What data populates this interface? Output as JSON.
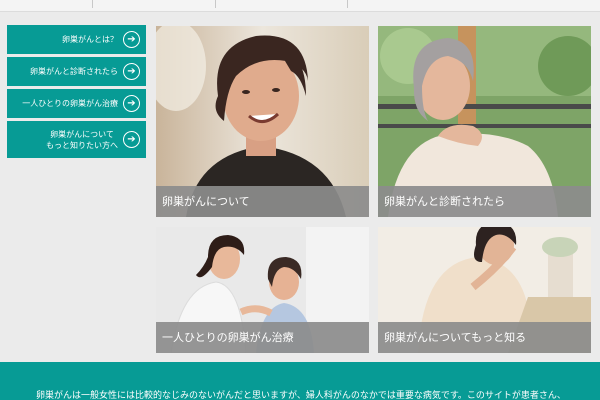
{
  "sidebar": {
    "items": [
      {
        "label": "卵巣がんとは？",
        "icon": "arrow-right-circle-icon"
      },
      {
        "label": "卵巣がんと診断されたら",
        "icon": "arrow-right-circle-icon"
      },
      {
        "label": "一人ひとりの卵巣がん治療",
        "icon": "arrow-right-circle-icon"
      },
      {
        "label": "卵巣がんについて\nもっと知りたい方へ",
        "icon": "arrow-right-circle-icon"
      }
    ]
  },
  "cards": [
    {
      "caption": "卵巣がんについて"
    },
    {
      "caption": "卵巣がんと診断されたら"
    },
    {
      "caption": "一人ひとりの卵巣がん治療"
    },
    {
      "caption": "卵巣がんについてもっと知る"
    }
  ],
  "footer": {
    "text": "卵巣がんは一般女性には比較的なじみのないがんだと思いますが、婦人科がんのなかでは重要な病気です。このサイトが患者さん、"
  },
  "colors": {
    "accent": "#079b95",
    "caption_bg": "#8c8c8c",
    "page_bg": "#ebebeb"
  }
}
